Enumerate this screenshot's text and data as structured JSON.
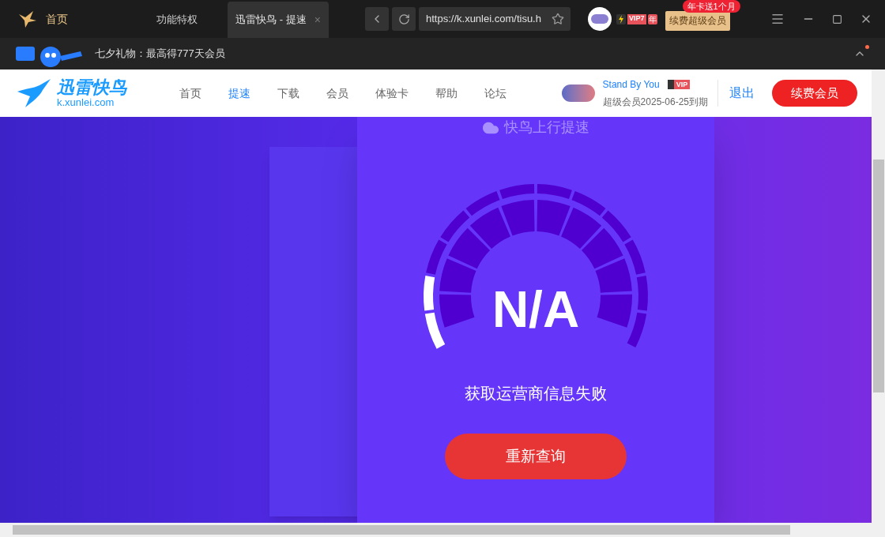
{
  "browser": {
    "home_label": "首页",
    "tabs": [
      {
        "label": "功能特权",
        "selected": false
      },
      {
        "label": "迅雷快鸟 - 提速",
        "selected": true,
        "close": "×"
      }
    ],
    "url": "https://k.xunlei.com/tisu.h",
    "vip_badge": "VIP7",
    "year_badge": "年",
    "renew_button": "续费超级会员",
    "promo_badge": "年卡送1个月"
  },
  "notice_bar": {
    "text": "七夕礼物：最高得777天会员",
    "unread": true
  },
  "site_header": {
    "logo_title": "迅雷快鸟",
    "logo_domain": "k.xunlei.com",
    "nav": [
      {
        "label": "首页",
        "selected": false
      },
      {
        "label": "提速",
        "selected": true
      },
      {
        "label": "下载",
        "selected": false
      },
      {
        "label": "会员",
        "selected": false
      },
      {
        "label": "体验卡",
        "selected": false
      },
      {
        "label": "帮助",
        "selected": false
      },
      {
        "label": "论坛",
        "selected": false
      }
    ],
    "user_name": "Stand By You",
    "user_badge": "VIP",
    "membership": "超级会员2025-06-25到期",
    "logout": "退出",
    "renew_button": "续费会员"
  },
  "speed_card": {
    "title": "快鸟上行提速",
    "reading": "N/A",
    "message": "获取运营商信息失败",
    "retry_button": "重新查询"
  }
}
